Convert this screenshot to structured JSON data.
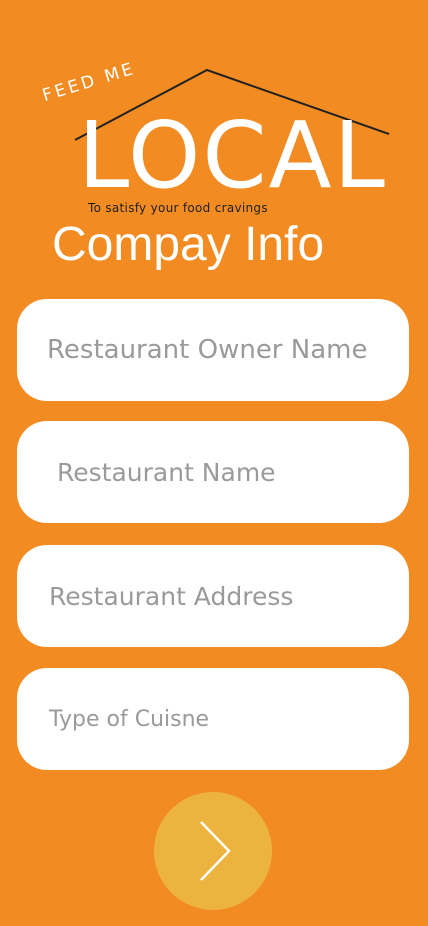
{
  "logo": {
    "feed_me": "FEED ME",
    "name": "LOCAL",
    "tagline": "To satisfy your food cravings"
  },
  "page": {
    "title": "Compay Info"
  },
  "form": {
    "owner_name_placeholder": "Restaurant Owner Name",
    "restaurant_name_placeholder": "Restaurant Name",
    "address_placeholder": "Restaurant Address",
    "cuisine_placeholder": "Type of Cuisne"
  },
  "next": {
    "icon": "chevron-right-icon"
  },
  "colors": {
    "background": "#F28C22",
    "field": "#FFFFFF",
    "placeholder": "#9A9A9A",
    "button": "#ECB43E"
  }
}
